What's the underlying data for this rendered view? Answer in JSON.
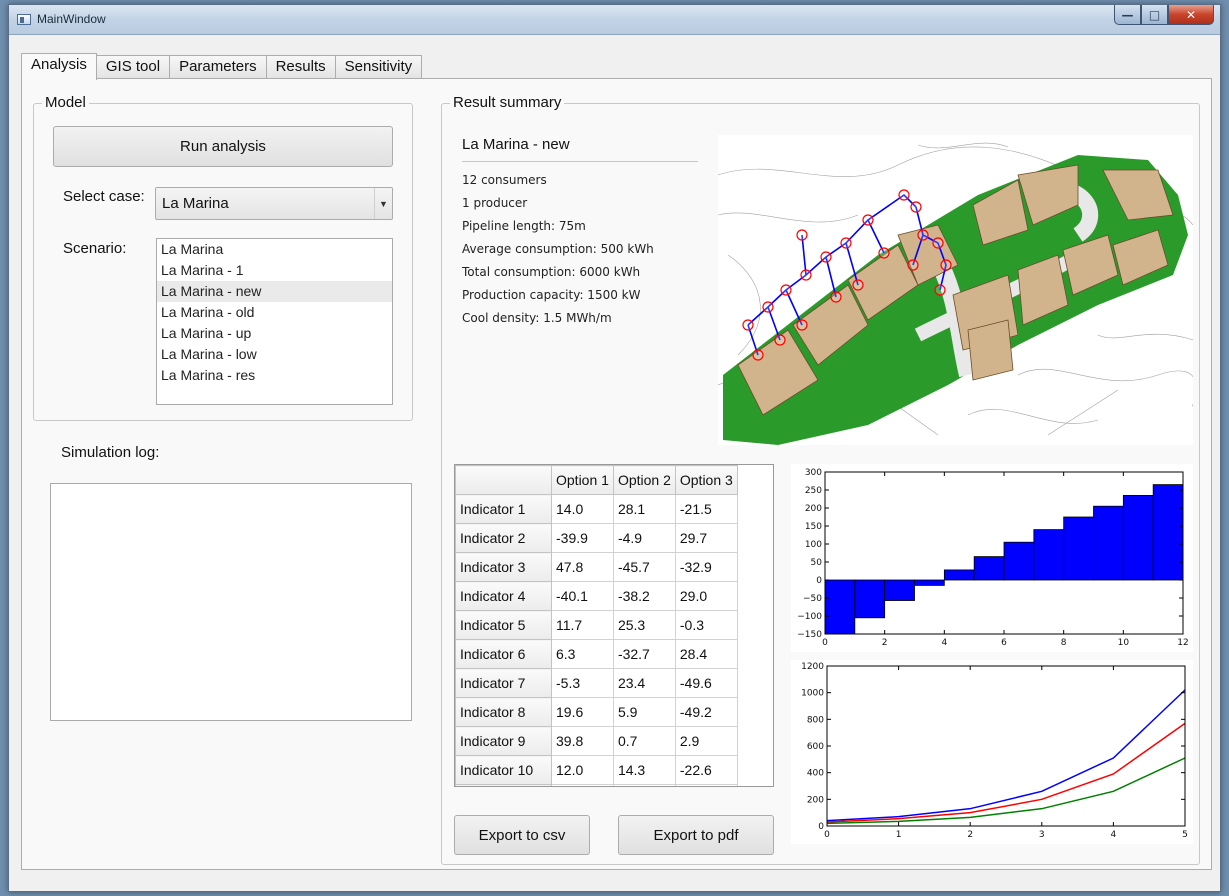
{
  "window": {
    "title": "MainWindow"
  },
  "tabs": [
    "Analysis",
    "GIS tool",
    "Parameters",
    "Results",
    "Sensitivity"
  ],
  "model": {
    "group_title": "Model",
    "run_label": "Run analysis",
    "select_case_label": "Select case:",
    "selected_case": "La Marina",
    "scenario_label": "Scenario:",
    "scenarios": [
      "La Marina",
      "La Marina - 1",
      "La Marina - new",
      "La Marina - old",
      "La Marina - up",
      "La Marina - low",
      "La Marina - res"
    ],
    "selected_scenario_index": 2
  },
  "log": {
    "label": "Simulation log:",
    "content": ""
  },
  "summary": {
    "group_title": "Result summary",
    "title": "La Marina - new",
    "lines": [
      "12 consumers",
      "1 producer",
      "Pipeline length: 75m",
      "Average consumption: 500 kWh",
      "Total consumption: 6000 kWh",
      "Production capacity: 1500 kW",
      "Cool density: 1.5 MWh/m"
    ]
  },
  "table": {
    "columns": [
      "Option 1",
      "Option 2",
      "Option 3"
    ],
    "rows": [
      {
        "label": "Indicator 1",
        "values": [
          "14.0",
          "28.1",
          "-21.5"
        ]
      },
      {
        "label": "Indicator 2",
        "values": [
          "-39.9",
          "-4.9",
          "29.7"
        ]
      },
      {
        "label": "Indicator 3",
        "values": [
          "47.8",
          "-45.7",
          "-32.9"
        ]
      },
      {
        "label": "Indicator 4",
        "values": [
          "-40.1",
          "-38.2",
          "29.0"
        ]
      },
      {
        "label": "Indicator 5",
        "values": [
          "11.7",
          "25.3",
          "-0.3"
        ]
      },
      {
        "label": "Indicator 6",
        "values": [
          "6.3",
          "-32.7",
          "28.4"
        ]
      },
      {
        "label": "Indicator 7",
        "values": [
          "-5.3",
          "23.4",
          "-49.6"
        ]
      },
      {
        "label": "Indicator 8",
        "values": [
          "19.6",
          "5.9",
          "-49.2"
        ]
      },
      {
        "label": "Indicator 9",
        "values": [
          "39.8",
          "0.7",
          "2.9"
        ]
      },
      {
        "label": "Indicator 10",
        "values": [
          "12.0",
          "14.3",
          "-22.6"
        ]
      }
    ]
  },
  "export": {
    "csv_label": "Export to csv",
    "pdf_label": "Export to pdf"
  },
  "colors": {
    "bar": "#0000ff",
    "line_blue": "#0000ff",
    "line_red": "#ff0000",
    "line_green": "#008000",
    "map_green": "#2a9b2a",
    "map_building": "#d2b48c"
  },
  "chart_data": [
    {
      "type": "bar",
      "x": [
        0,
        1,
        2,
        3,
        4,
        5,
        6,
        7,
        8,
        9,
        10,
        11
      ],
      "values": [
        -150,
        -105,
        -57,
        -15,
        28,
        65,
        105,
        140,
        175,
        205,
        235,
        265
      ],
      "xlim": [
        0,
        12
      ],
      "ylim": [
        -150,
        300
      ],
      "xticks": [
        0,
        2,
        4,
        6,
        8,
        10,
        12
      ],
      "yticks": [
        -150,
        -100,
        -50,
        0,
        50,
        100,
        150,
        200,
        250,
        300
      ]
    },
    {
      "type": "line",
      "x": [
        0,
        1,
        2,
        3,
        4,
        5
      ],
      "series": [
        {
          "color": "#0000ff",
          "values": [
            40,
            70,
            130,
            260,
            510,
            1020
          ]
        },
        {
          "color": "#ff0000",
          "values": [
            30,
            55,
            100,
            200,
            390,
            770
          ]
        },
        {
          "color": "#008000",
          "values": [
            20,
            35,
            65,
            130,
            260,
            510
          ]
        }
      ],
      "xlim": [
        0,
        5
      ],
      "ylim": [
        0,
        1200
      ],
      "xticks": [
        0,
        1,
        2,
        3,
        4,
        5
      ],
      "yticks": [
        0,
        200,
        400,
        600,
        800,
        1000,
        1200
      ]
    }
  ]
}
